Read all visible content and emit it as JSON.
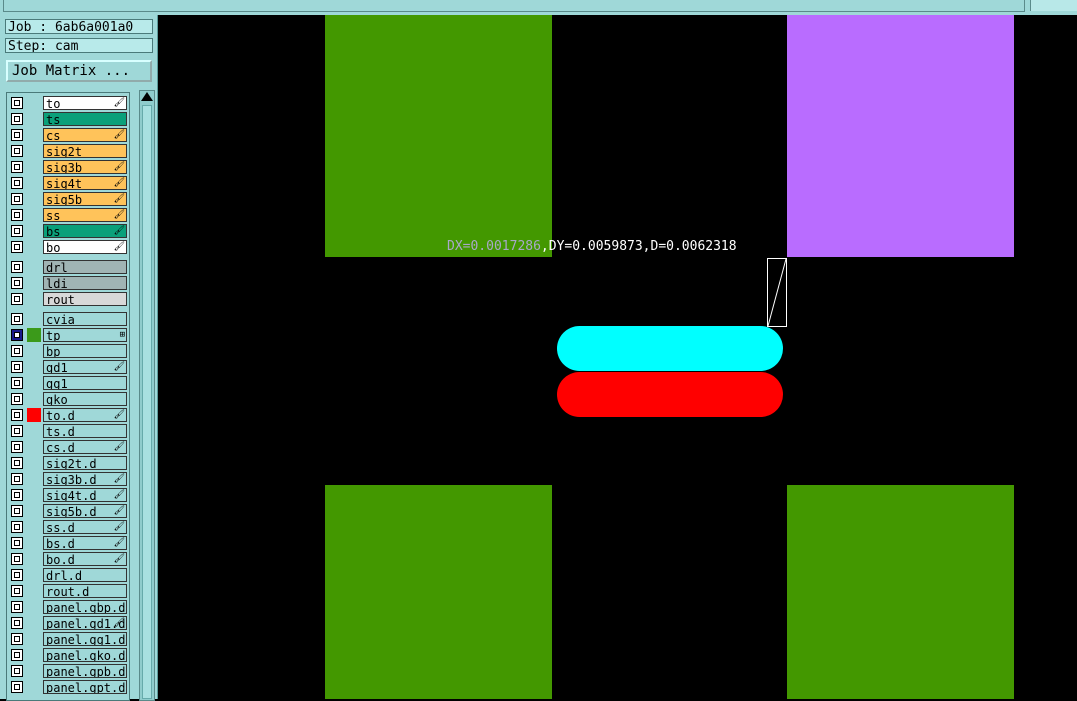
{
  "header": {
    "job_label": "Job : 6ab6a001a0",
    "step_label": "Step: cam",
    "job_matrix_button": "Job Matrix ..."
  },
  "colors": {
    "panel": "#9fd8d8",
    "green_pad": "#439800",
    "purple_pad": "#b96cff",
    "cyan_pad": "#00ffff",
    "red_pad": "#ff0000",
    "canvas": "#000000"
  },
  "layers": [
    {
      "name": "to",
      "bg": "#ffffff",
      "mark": "🖌",
      "swatch": ""
    },
    {
      "name": "ts",
      "bg": "#0aa07a",
      "mark": "",
      "swatch": ""
    },
    {
      "name": "cs",
      "bg": "#ffc35a",
      "mark": "🖌",
      "swatch": ""
    },
    {
      "name": "sig2t",
      "bg": "#ffc35a",
      "mark": "",
      "swatch": ""
    },
    {
      "name": "sig3b",
      "bg": "#ffc35a",
      "mark": "🖌",
      "swatch": ""
    },
    {
      "name": "sig4t",
      "bg": "#ffc35a",
      "mark": "🖌",
      "swatch": ""
    },
    {
      "name": "sig5b",
      "bg": "#ffc35a",
      "mark": "🖌",
      "swatch": ""
    },
    {
      "name": "ss",
      "bg": "#ffc35a",
      "mark": "🖌",
      "swatch": ""
    },
    {
      "name": "bs",
      "bg": "#0aa07a",
      "mark": "🖌",
      "swatch": ""
    },
    {
      "name": "bo",
      "bg": "#ffffff",
      "mark": "🖌",
      "swatch": ""
    },
    {
      "name": "drl",
      "bg": "#a0b4b4",
      "mark": "",
      "swatch": ""
    },
    {
      "name": "ldi",
      "bg": "#a0b4b4",
      "mark": "",
      "swatch": ""
    },
    {
      "name": "rout",
      "bg": "#d8d8d8",
      "mark": "",
      "swatch": ""
    },
    {
      "name": "cvia",
      "bg": "#9fd8d8",
      "mark": "",
      "swatch": ""
    },
    {
      "name": "tp",
      "bg": "#9fd8d8",
      "mark": "⊞",
      "swatch": "#3b9a1a",
      "selected": true
    },
    {
      "name": "bp",
      "bg": "#9fd8d8",
      "mark": "",
      "swatch": ""
    },
    {
      "name": "gd1",
      "bg": "#9fd8d8",
      "mark": "🖌",
      "swatch": ""
    },
    {
      "name": "gg1",
      "bg": "#9fd8d8",
      "mark": "",
      "swatch": ""
    },
    {
      "name": "gko",
      "bg": "#9fd8d8",
      "mark": "",
      "swatch": ""
    },
    {
      "name": "to.d",
      "bg": "#9fd8d8",
      "mark": "🖌",
      "swatch": "#ff0000"
    },
    {
      "name": "ts.d",
      "bg": "#9fd8d8",
      "mark": "",
      "swatch": ""
    },
    {
      "name": "cs.d",
      "bg": "#9fd8d8",
      "mark": "🖌",
      "swatch": ""
    },
    {
      "name": "sig2t.d",
      "bg": "#9fd8d8",
      "mark": "",
      "swatch": ""
    },
    {
      "name": "sig3b.d",
      "bg": "#9fd8d8",
      "mark": "🖌",
      "swatch": ""
    },
    {
      "name": "sig4t.d",
      "bg": "#9fd8d8",
      "mark": "🖌",
      "swatch": ""
    },
    {
      "name": "sig5b.d",
      "bg": "#9fd8d8",
      "mark": "🖌",
      "swatch": ""
    },
    {
      "name": "ss.d",
      "bg": "#9fd8d8",
      "mark": "🖌",
      "swatch": ""
    },
    {
      "name": "bs.d",
      "bg": "#9fd8d8",
      "mark": "🖌",
      "swatch": ""
    },
    {
      "name": "bo.d",
      "bg": "#9fd8d8",
      "mark": "🖌",
      "swatch": ""
    },
    {
      "name": "drl.d",
      "bg": "#9fd8d8",
      "mark": "",
      "swatch": ""
    },
    {
      "name": "rout.d",
      "bg": "#9fd8d8",
      "mark": "",
      "swatch": ""
    },
    {
      "name": "panel.gbp.d",
      "bg": "#9fd8d8",
      "mark": "",
      "swatch": ""
    },
    {
      "name": "panel.gd1.d",
      "bg": "#9fd8d8",
      "mark": "🖌",
      "swatch": ""
    },
    {
      "name": "panel.gg1.d",
      "bg": "#9fd8d8",
      "mark": "",
      "swatch": ""
    },
    {
      "name": "panel.gko.d",
      "bg": "#9fd8d8",
      "mark": "",
      "swatch": ""
    },
    {
      "name": "panel.gpb.d",
      "bg": "#9fd8d8",
      "mark": "",
      "swatch": ""
    },
    {
      "name": "panel.gpt.d",
      "bg": "#9fd8d8",
      "mark": "",
      "swatch": ""
    }
  ],
  "measurement": {
    "dx_prefix": "DX=0.0017286",
    "rest": ",DY=0.0059873,D=0.0062318"
  }
}
